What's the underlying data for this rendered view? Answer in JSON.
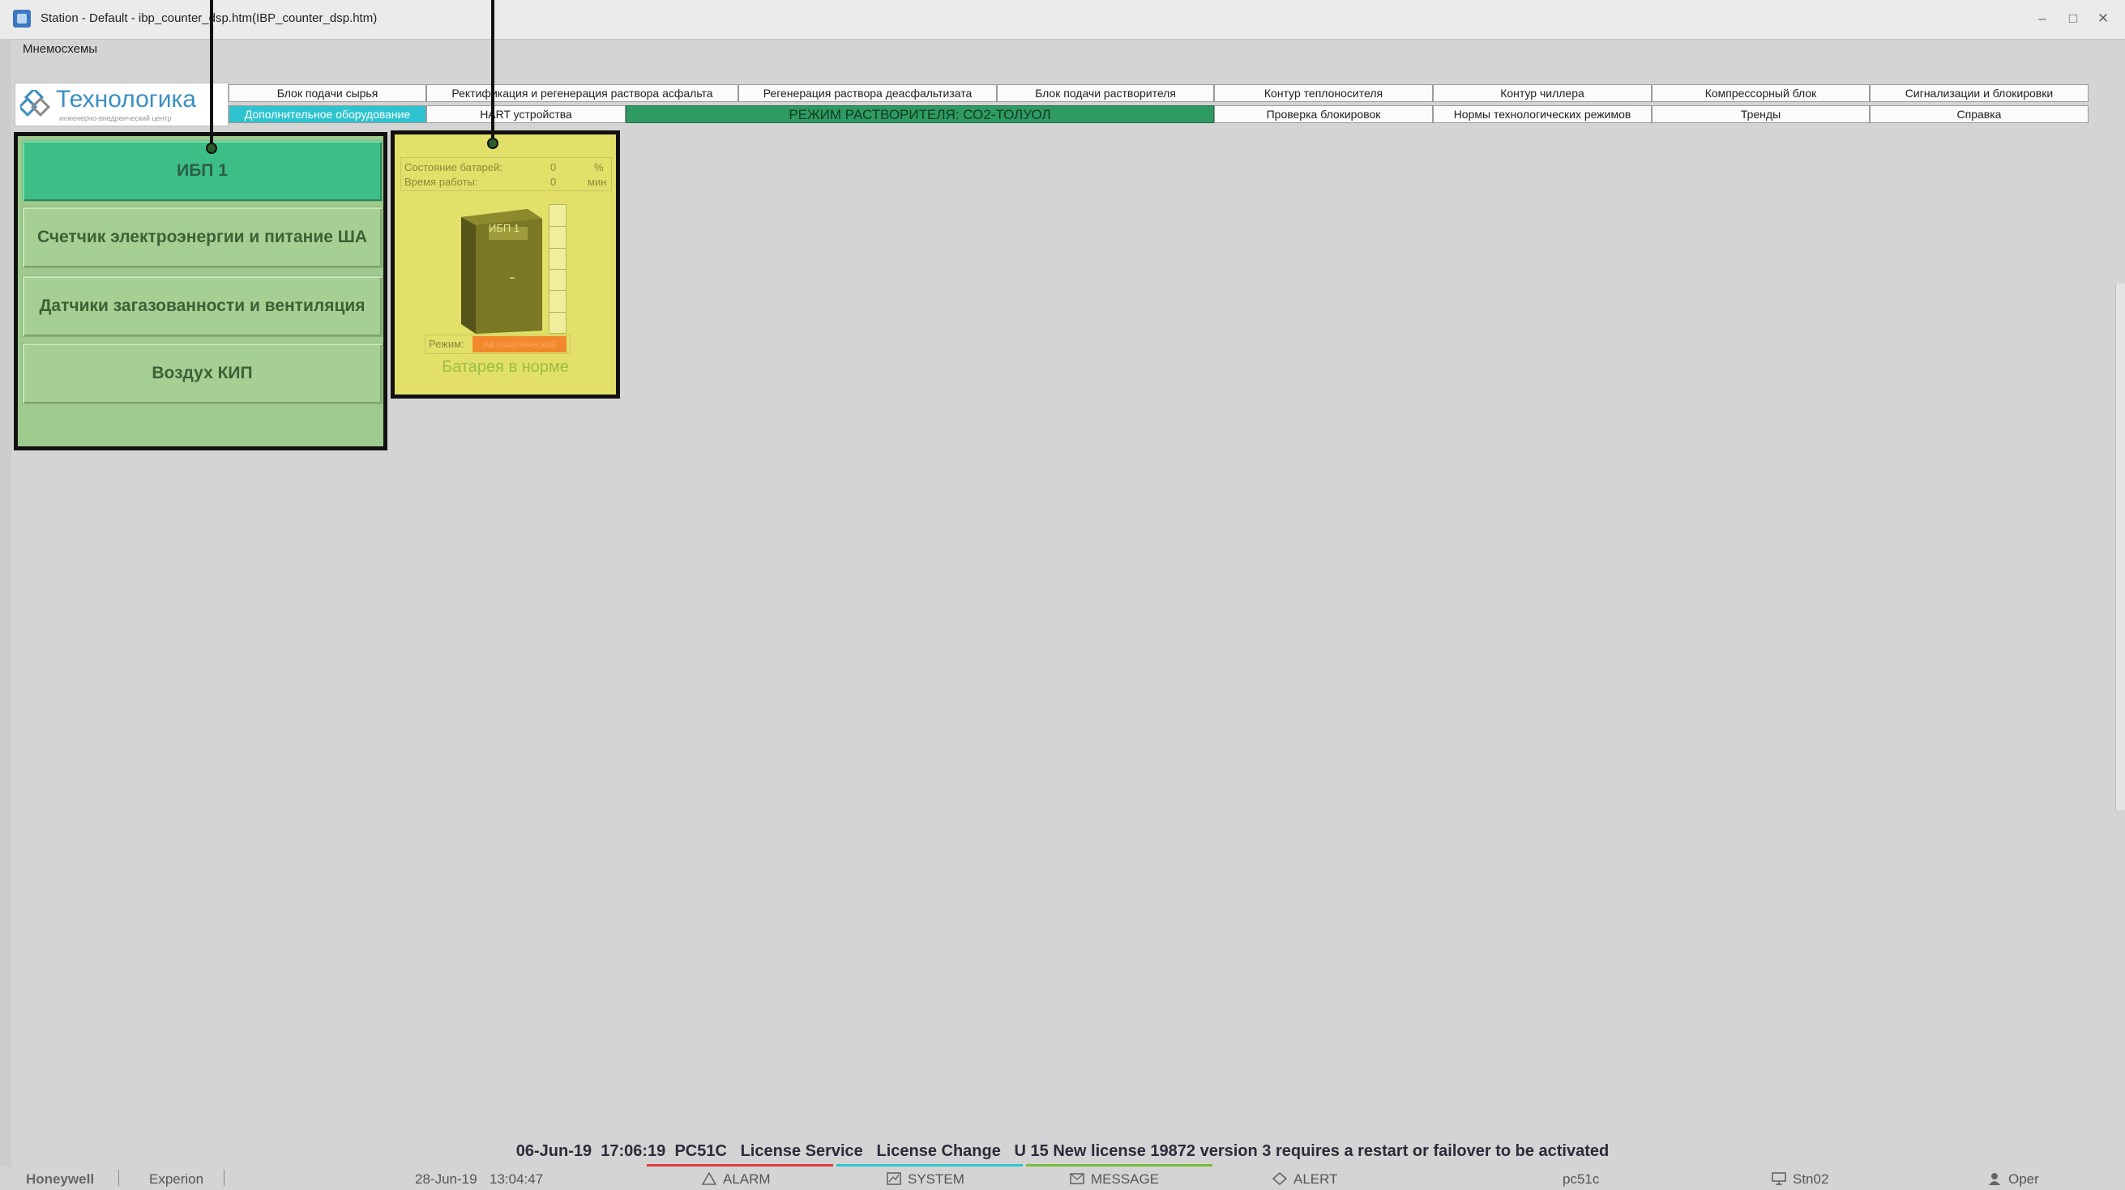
{
  "window": {
    "title": "Station - Default - ibp_counter_dsp.htm(IBP_counter_dsp.htm)",
    "controls": [
      "–",
      "□",
      "✕"
    ]
  },
  "menu": {
    "item": "Мнемосхемы"
  },
  "logo": {
    "title": "Технологика",
    "subtitle": "инженерно-внедренческий центр"
  },
  "nav": {
    "row1": [
      "Блок подачи сырья",
      "Ректификация и регенерация раствора асфальта",
      "Регенерация раствора деасфальтизата",
      "Блок подачи растворителя",
      "Контур теплоносителя",
      "Контур чиллера",
      "Компрессорный блок",
      "Сигнализации и блокировки"
    ],
    "row2": [
      "Дополнительное оборудование",
      "HART устройства",
      "РЕЖИМ РАСТВОРИТЕЛЯ: СО2-ТОЛУОЛ",
      "Проверка блокировок",
      "Нормы технологических режимов",
      "Тренды",
      "Справка"
    ]
  },
  "side_menu": [
    "ИБП 1",
    "Счетчик электроэнергии и питание ША",
    "Датчики загазованности и вентиляция",
    "Воздух КИП"
  ],
  "ups": {
    "battery_state_label": "Состояние батарей:",
    "battery_state_value": "0",
    "battery_state_unit": "%",
    "runtime_label": "Время работы:",
    "runtime_value": "0",
    "runtime_unit": "мин",
    "image_label": "ИБП 1",
    "mode_label": "Режим:",
    "mode_value": "Автоматический",
    "status": "Батарея в норме",
    "battery_level": 0
  },
  "message": {
    "date": "06-Jun-19",
    "time": "17:06:19",
    "node": "PC51C",
    "source": "License Service",
    "type": "License Change",
    "text": "U 15 New license 19872 version 3 requires a restart or failover to be activated"
  },
  "statusbar": {
    "brand": "Honeywell",
    "product": "Experion",
    "date": "28-Jun-19",
    "time": "13:04:47",
    "alarm": "ALARM",
    "system": "SYSTEM",
    "message": "MESSAGE",
    "alert": "ALERT",
    "node": "pc51c",
    "station": "Stn02",
    "user": "Oper"
  },
  "colors": {
    "alarm_underline": "#e23b3b",
    "system_underline": "#2ec4cf",
    "message_underline": "#7dbb3c",
    "active_nav": "#2ec4cf",
    "mode_banner": "#2f9b63",
    "ups_card": "#e2e068",
    "side_panel": "#9ecb8d",
    "side_active": "#3dbe86"
  }
}
